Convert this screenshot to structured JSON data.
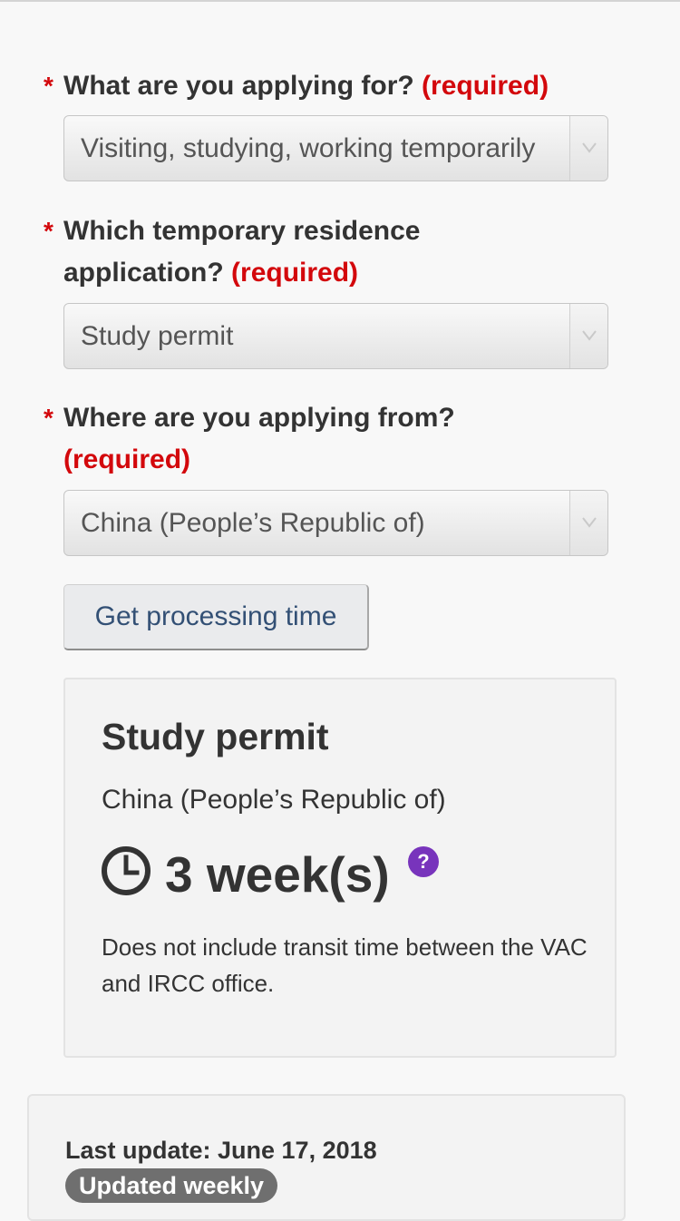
{
  "form": {
    "field1": {
      "asterisk": "*",
      "label": "What are you applying for?",
      "required": "(required)",
      "value": "Visiting, studying, working temporarily"
    },
    "field2": {
      "asterisk": "*",
      "label_line1": "Which temporary residence",
      "label_line2": "application?",
      "required": "(required)",
      "value": "Study permit"
    },
    "field3": {
      "asterisk": "*",
      "label": "Where are you applying from?",
      "required": "(required)",
      "value": "China (People’s Republic of)"
    },
    "submit_label": "Get processing time"
  },
  "result": {
    "title": "Study permit",
    "country": "China (People’s Republic of)",
    "duration": "3 week(s)",
    "help_symbol": "?",
    "note": "Does not include transit time between the VAC and IRCC office."
  },
  "footer": {
    "last_update": "Last update: June 17, 2018",
    "badge": "Updated weekly"
  },
  "icons": {
    "clock": "clock-icon",
    "help": "question-mark-icon",
    "dropdown": "chevron-down-icon"
  },
  "colors": {
    "required": "#d3080c",
    "button_text": "#335075",
    "help_badge": "#7834bc",
    "update_badge": "#6f6f6f"
  }
}
